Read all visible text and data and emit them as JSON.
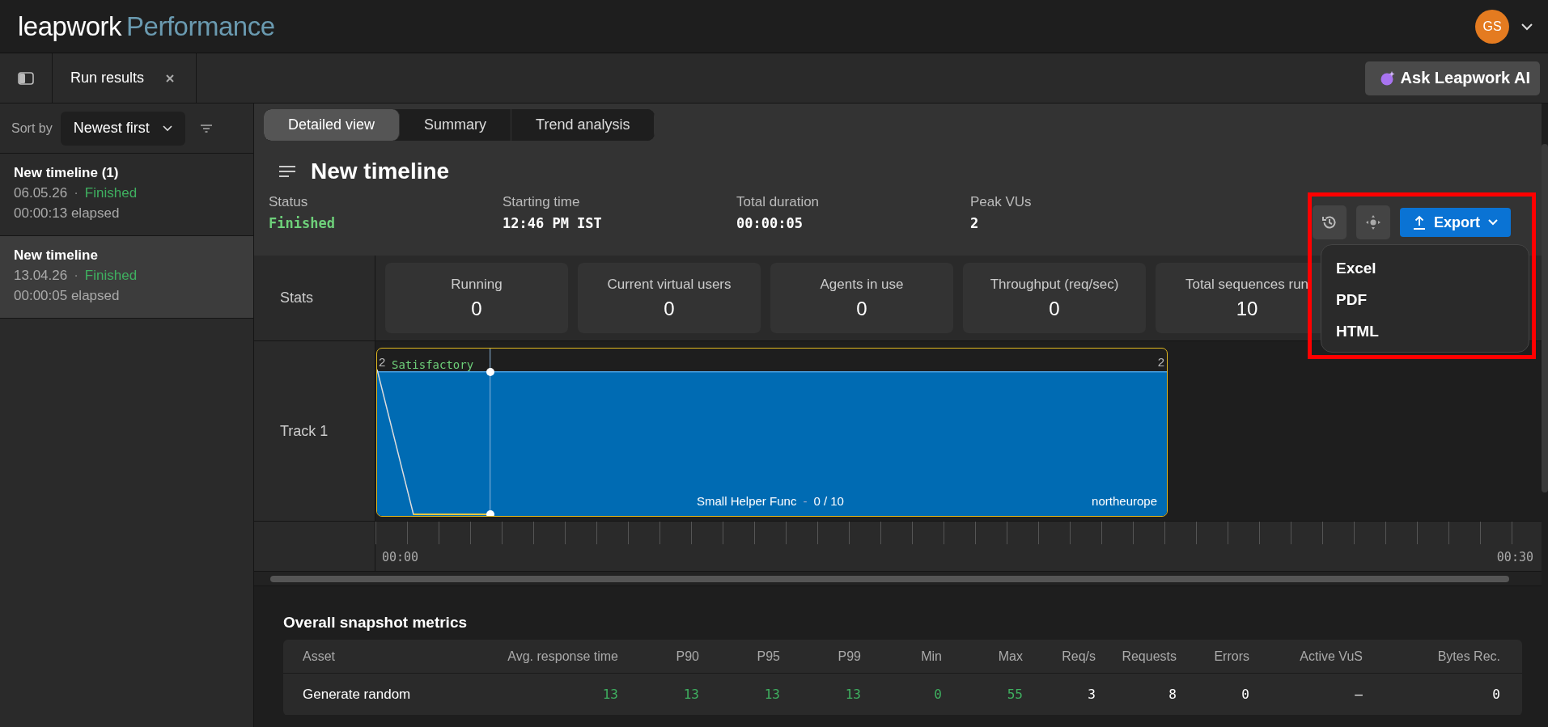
{
  "header": {
    "logo_word": "leapwork",
    "logo_product": "Performance",
    "avatar": "GS"
  },
  "tabbar": {
    "tabs": [
      {
        "label": "Run results",
        "selected": true
      }
    ],
    "ai_button": "Ask Leapwork AI"
  },
  "sidebar": {
    "sort_label": "Sort by",
    "sort_value": "Newest first",
    "separator": "·",
    "runs": [
      {
        "name": "New timeline (1)",
        "date": "06.05.26",
        "status": "Finished",
        "elapsed": "00:00:13 elapsed",
        "selected": false
      },
      {
        "name": "New timeline",
        "date": "13.04.26",
        "status": "Finished",
        "elapsed": "00:00:05 elapsed",
        "selected": true
      }
    ]
  },
  "view_tabs": [
    {
      "label": "Detailed view",
      "selected": true
    },
    {
      "label": "Summary",
      "selected": false
    },
    {
      "label": "Trend analysis",
      "selected": false
    }
  ],
  "title": "New timeline",
  "info": [
    {
      "label": "Status",
      "value": "Finished",
      "kind": "status"
    },
    {
      "label": "Starting time",
      "value": "12:46 PM IST",
      "kind": "plain"
    },
    {
      "label": "Total duration",
      "value": "00:00:05",
      "kind": "plain"
    },
    {
      "label": "Peak VUs",
      "value": "2",
      "kind": "plain"
    }
  ],
  "export": {
    "label": "Export",
    "menu": [
      "Excel",
      "PDF",
      "HTML"
    ]
  },
  "stats": {
    "label": "Stats",
    "cards": [
      {
        "label": "Running",
        "value": "0"
      },
      {
        "label": "Current virtual users",
        "value": "0"
      },
      {
        "label": "Agents in use",
        "value": "0"
      },
      {
        "label": "Throughput (req/sec)",
        "value": "0"
      },
      {
        "label": "Total sequences run",
        "value": "10"
      }
    ]
  },
  "tracks": [
    {
      "label": "Track 1",
      "start_value": "2",
      "end_value": "2",
      "rating": "Satisfactory",
      "sequence": "Small Helper Func",
      "separator": "-",
      "progress": "0 / 10",
      "region": "northeurope"
    }
  ],
  "timeline": {
    "start": "00:00",
    "end": "00:30"
  },
  "metrics": {
    "title": "Overall snapshot metrics",
    "columns": [
      {
        "label": "Asset",
        "kind": "name"
      },
      {
        "label": "Avg. response time",
        "kind": "timing"
      },
      {
        "label": "P90",
        "kind": "timing"
      },
      {
        "label": "P95",
        "kind": "timing"
      },
      {
        "label": "P99",
        "kind": "timing"
      },
      {
        "label": "Min",
        "kind": "timing"
      },
      {
        "label": "Max",
        "kind": "timing"
      },
      {
        "label": "Req/s",
        "kind": "count"
      },
      {
        "label": "Requests",
        "kind": "count"
      },
      {
        "label": "Errors",
        "kind": "count"
      },
      {
        "label": "Active VuS",
        "kind": "count"
      },
      {
        "label": "Bytes Rec.",
        "kind": "count"
      }
    ],
    "rows": [
      {
        "cells": [
          "Generate random",
          "13",
          "13",
          "13",
          "13",
          "0",
          "55",
          "3",
          "8",
          "0",
          "–",
          "0"
        ]
      }
    ]
  }
}
